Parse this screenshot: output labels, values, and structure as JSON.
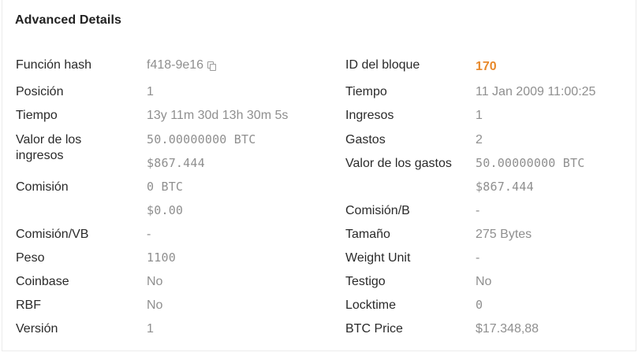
{
  "title": "Advanced Details",
  "left": {
    "hash_label": "Función hash",
    "hash_value": "f418-9e16",
    "position_label": "Posición",
    "position_value": "1",
    "time_label": "Tiempo",
    "time_value": "13y 11m 30d 13h 30m 5s",
    "input_value_label_1": "Valor de los",
    "input_value_label_2": "ingresos",
    "input_value_btc": "50.00000000 BTC",
    "input_value_usd": "$867.444",
    "fee_label": "Comisión",
    "fee_btc": "0 BTC",
    "fee_usd": "$0.00",
    "fee_vb_label": "Comisión/VB",
    "fee_vb_value": "-",
    "weight_label": "Peso",
    "weight_value": "1100",
    "coinbase_label": "Coinbase",
    "coinbase_value": "No",
    "rbf_label": "RBF",
    "rbf_value": "No",
    "version_label": "Versión",
    "version_value": "1"
  },
  "right": {
    "block_id_label": "ID del bloque",
    "block_id_value": "170",
    "time_label": "Tiempo",
    "time_value": "11 Jan 2009 11:00:25",
    "inputs_label": "Ingresos",
    "inputs_value": "1",
    "outputs_label": "Gastos",
    "outputs_value": "2",
    "output_value_label": "Valor de los gastos",
    "output_value_btc": "50.00000000 BTC",
    "output_value_usd": "$867.444",
    "fee_b_label": "Comisión/B",
    "fee_b_value": "-",
    "size_label": "Tamaño",
    "size_value": "275 Bytes",
    "weight_unit_label": "Weight Unit",
    "weight_unit_value": "-",
    "witness_label": "Testigo",
    "witness_value": "No",
    "locktime_label": "Locktime",
    "locktime_value": "0",
    "btc_price_label": "BTC Price",
    "btc_price_value": "$17.348,88"
  },
  "colors": {
    "accent": "#e8892b",
    "label": "#2a2a2a",
    "value": "#8f8f8f"
  },
  "icons": {
    "copy": "copy-icon"
  }
}
